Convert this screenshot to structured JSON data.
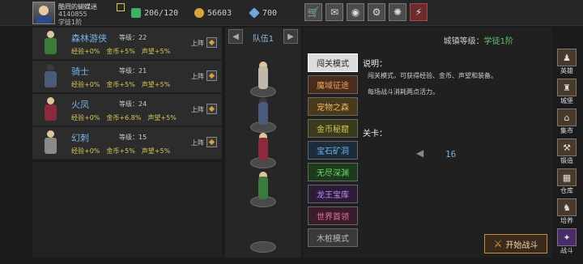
{
  "player": {
    "name": "酷冏的蝴蝶迷",
    "id_text": "4140855",
    "title": "学徒1阶"
  },
  "resources": {
    "energy": "206/120",
    "gold": "56603",
    "gems": "700"
  },
  "toolbar_icons": [
    "shop-icon",
    "mail-icon",
    "gamepad-icon",
    "settings-icon",
    "color-wheel-icon",
    "alert-icon"
  ],
  "heroes": [
    {
      "name": "森林游侠",
      "level": "等级：22",
      "exp": "经验+0%",
      "gold": "金币+5%",
      "fame": "声望+5%",
      "deploy": "上阵",
      "color": "#3b7a3b"
    },
    {
      "name": "骑士",
      "level": "等级：21",
      "exp": "经验+0%",
      "gold": "金币+5%",
      "fame": "声望+5%",
      "deploy": "上阵",
      "color": "#4a5a7a"
    },
    {
      "name": "火凤",
      "level": "等级：24",
      "exp": "经验+0%",
      "gold": "金币+6.8%",
      "fame": "声望+5%",
      "deploy": "上阵",
      "color": "#8a2a3a"
    },
    {
      "name": "幻刺",
      "level": "等级：15",
      "exp": "经验+0%",
      "gold": "金币+5%",
      "fame": "声望+5%",
      "deploy": "上阵",
      "color": "#8a8a8a"
    }
  ],
  "team": {
    "label": "队伍1",
    "slot_colors": [
      "#c0b8a8",
      "#4a5a7a",
      "#8a2a3a",
      "#3b7a3b"
    ]
  },
  "city": {
    "label": "城镇等级：",
    "value": "学徒1阶"
  },
  "modes": [
    "闯关模式",
    "魔域征途",
    "宠物之森",
    "金币秘窟",
    "宝石矿洞",
    "无尽深渊",
    "龙王宝库",
    "世界首领",
    "木桩模式"
  ],
  "description": {
    "title": "说明：",
    "line1": "闯关模式，可获得经验、金币、声望和装备。",
    "line2": "每场战斗消耗两点活力。"
  },
  "stage": {
    "title": "关卡：",
    "number": "16"
  },
  "start_button": "开始战斗",
  "nav": [
    {
      "label": "英雄",
      "icon": "hero-icon"
    },
    {
      "label": "城堡",
      "icon": "castle-icon"
    },
    {
      "label": "集市",
      "icon": "market-icon"
    },
    {
      "label": "锻造",
      "icon": "anvil-icon"
    },
    {
      "label": "仓库",
      "icon": "warehouse-icon"
    },
    {
      "label": "培养",
      "icon": "train-icon"
    },
    {
      "label": "战斗",
      "icon": "battle-icon"
    }
  ]
}
